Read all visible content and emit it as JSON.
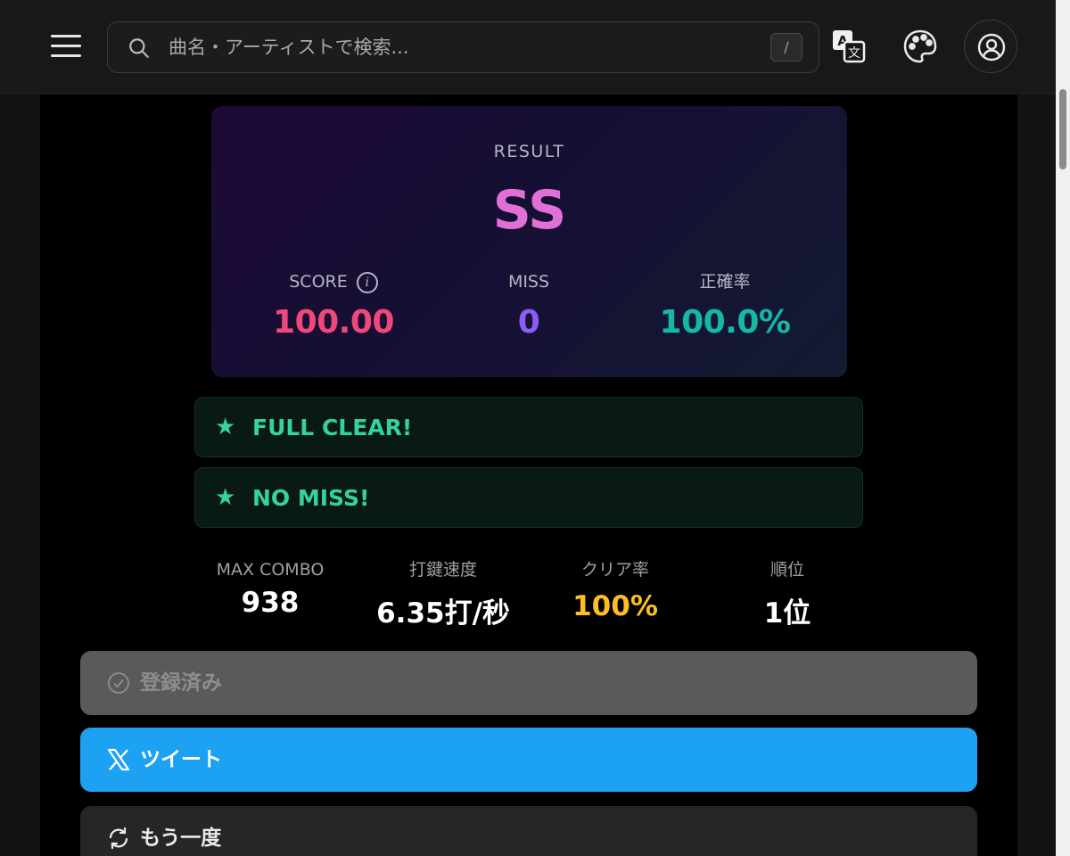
{
  "header": {
    "search_placeholder": "曲名・アーティストで検索...",
    "slash_key": "/"
  },
  "result": {
    "label": "RESULT",
    "rank": "SS",
    "score_label": "SCORE",
    "score_value": "100.00",
    "miss_label": "MISS",
    "miss_value": "0",
    "accuracy_label": "正確率",
    "accuracy_value": "100.0%"
  },
  "badges": [
    {
      "star": "★",
      "text": "FULL CLEAR!"
    },
    {
      "star": "★",
      "text": "NO MISS!"
    }
  ],
  "stats": [
    {
      "label": "MAX COMBO",
      "value": "938"
    },
    {
      "label": "打鍵速度",
      "value": "6.35打/秒"
    },
    {
      "label": "クリア率",
      "value": "100%"
    },
    {
      "label": "順位",
      "value": "1位"
    }
  ],
  "actions": {
    "registered": "登録済み",
    "tweet": "ツイート",
    "retry": "もう一度"
  },
  "colors": {
    "rank": "#e06fd6",
    "score": "#f0487a",
    "miss": "#8b5cf6",
    "accuracy": "#14b8a6",
    "badge_text": "#34d399",
    "clear_rate": "#fbbf24",
    "tweet_button": "#1da1f2"
  },
  "icons": {
    "menu": "hamburger-icon",
    "search": "search-icon",
    "translate": "translate-icon",
    "palette": "palette-icon",
    "account": "user-circle-icon",
    "info": "info-icon",
    "registered": "check-circle-icon",
    "tweet": "x-logo-icon",
    "retry": "refresh-icon"
  }
}
